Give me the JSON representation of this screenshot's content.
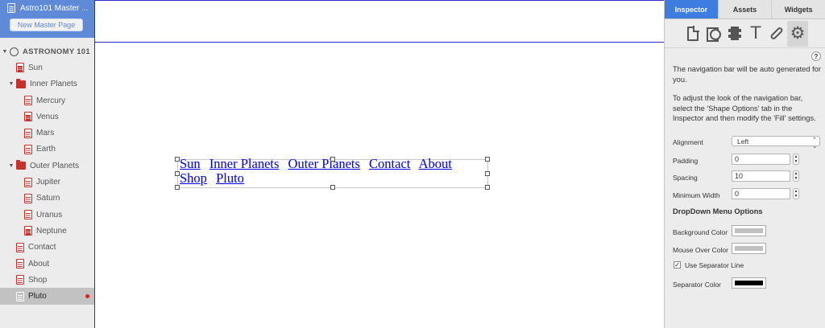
{
  "sidebar": {
    "master_title": "Astro101 Master ...",
    "new_master_label": "New Master Page",
    "tree": [
      {
        "label": "ASTRONOMY 101",
        "kind": "root",
        "level": 0,
        "disclosure": "▼",
        "icon": "globe-icon"
      },
      {
        "label": "Sun",
        "kind": "page",
        "level": 1,
        "icon": "page-icon"
      },
      {
        "label": "Inner Planets",
        "kind": "folder",
        "level": 1,
        "disclosure": "▼",
        "icon": "folder-icon"
      },
      {
        "label": "Mercury",
        "kind": "page",
        "level": 2,
        "icon": "page-icon"
      },
      {
        "label": "Venus",
        "kind": "page",
        "level": 2,
        "icon": "page-icon"
      },
      {
        "label": "Mars",
        "kind": "page",
        "level": 2,
        "icon": "page-icon"
      },
      {
        "label": "Earth",
        "kind": "page",
        "level": 2,
        "icon": "page-icon"
      },
      {
        "label": "Outer Planets",
        "kind": "folder",
        "level": 1,
        "disclosure": "▼",
        "icon": "folder-icon"
      },
      {
        "label": "Jupiter",
        "kind": "page",
        "level": 2,
        "icon": "page-icon"
      },
      {
        "label": "Saturn",
        "kind": "page",
        "level": 2,
        "icon": "page-icon"
      },
      {
        "label": "Uranus",
        "kind": "page",
        "level": 2,
        "icon": "page-icon"
      },
      {
        "label": "Neptune",
        "kind": "page",
        "level": 2,
        "icon": "page-icon"
      },
      {
        "label": "Contact",
        "kind": "page",
        "level": 1,
        "icon": "page-icon"
      },
      {
        "label": "About",
        "kind": "page",
        "level": 1,
        "icon": "page-icon"
      },
      {
        "label": "Shop",
        "kind": "page",
        "level": 1,
        "icon": "page-icon"
      },
      {
        "label": "Pluto",
        "kind": "page",
        "level": 1,
        "icon": "page-icon",
        "selected": true,
        "modified": true
      }
    ]
  },
  "canvas": {
    "nav_links": [
      "Sun",
      "Inner Planets",
      "Outer Planets",
      "Contact",
      "About",
      "Shop",
      "Pluto"
    ]
  },
  "inspector": {
    "tabs": [
      {
        "label": "Inspector",
        "active": true
      },
      {
        "label": "Assets",
        "active": false
      },
      {
        "label": "Widgets",
        "active": false
      }
    ],
    "toolbar_icons": [
      "document-icon",
      "shape-icon",
      "media-icon",
      "text-icon",
      "link-icon",
      "gear-icon"
    ],
    "help_label": "?",
    "description_1": "The navigation bar will be auto generated for you.",
    "description_2": "To adjust the look of the navigation bar, select the 'Shape Options' tab in the Inspector and then modify the 'Fill' settings.",
    "alignment": {
      "label": "Alignment",
      "value": "Left"
    },
    "padding": {
      "label": "Padding",
      "value": "0"
    },
    "spacing": {
      "label": "Spacing",
      "value": "10"
    },
    "min_width": {
      "label": "Minimum Width",
      "value": "0"
    },
    "dropdown_heading": "DropDown Menu Options",
    "bg_color": {
      "label": "Background Color",
      "color": "#c0c0c0"
    },
    "mouse_over_color": {
      "label": "Mouse Over Color",
      "color": "#c0c0c0"
    },
    "use_separator": {
      "label": "Use Separator Line",
      "checked": true,
      "mark": "✓"
    },
    "separator_color": {
      "label": "Separator Color",
      "color": "#000000"
    }
  },
  "colors": {
    "accent": "#3d7de0",
    "master_header": "#5e8ad7",
    "page_icon": "#c9302c",
    "canvas_guide": "#2a2ad0",
    "link": "#0000ee"
  }
}
